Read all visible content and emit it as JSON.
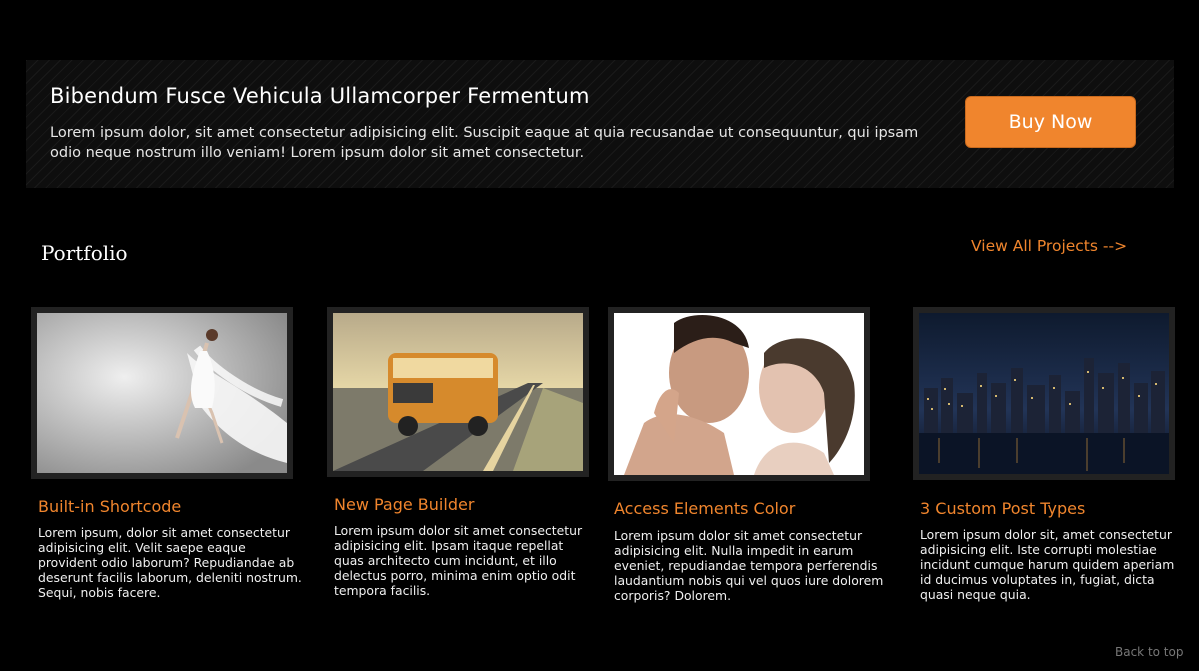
{
  "promo": {
    "title": "Bibendum Fusce Vehicula Ullamcorper Fermentum",
    "text": "Lorem ipsum dolor, sit amet consectetur adipisicing elit. Suscipit eaque at quia recusandae ut consequuntur, qui ipsam odio neque nostrum illo veniam! Lorem ipsum dolor sit amet consectetur.",
    "button_label": "Buy Now"
  },
  "portfolio": {
    "title": "Portfolio",
    "view_all": "View All Projects -->",
    "items": [
      {
        "title": "Built-in Shortcode",
        "text": "Lorem ipsum, dolor sit amet consectetur adipisicing elit. Velit saepe eaque provident odio laborum? Repudiandae ab deserunt facilis laborum, deleniti nostrum. Sequi, nobis facere.",
        "image": "dancer-in-white-dress"
      },
      {
        "title": "New Page Builder",
        "text": "Lorem ipsum dolor sit amet consectetur adipisicing elit. Ipsam itaque repellat quas architecto cum incidunt, et illo delectus porro, minima enim optio odit tempora facilis.",
        "image": "vintage-bus-on-road"
      },
      {
        "title": "Access Elements Color",
        "text": "Lorem ipsum dolor sit amet consectetur adipisicing elit. Nulla impedit in earum eveniet, repudiandae tempora perferendis laudantium nobis qui vel quos iure dolorem corporis? Dolorem.",
        "image": "couple-portrait"
      },
      {
        "title": "3 Custom Post Types",
        "text": "Lorem ipsum dolor sit, amet consectetur adipisicing elit. Iste corrupti molestiae incidunt cumque harum quidem aperiam id ducimus voluptates in, fugiat, dicta quasi neque quia.",
        "image": "city-skyline-at-night"
      }
    ]
  },
  "footer": {
    "back_to_top": "Back to top"
  },
  "colors": {
    "accent": "#f0852d",
    "background": "#000000"
  }
}
